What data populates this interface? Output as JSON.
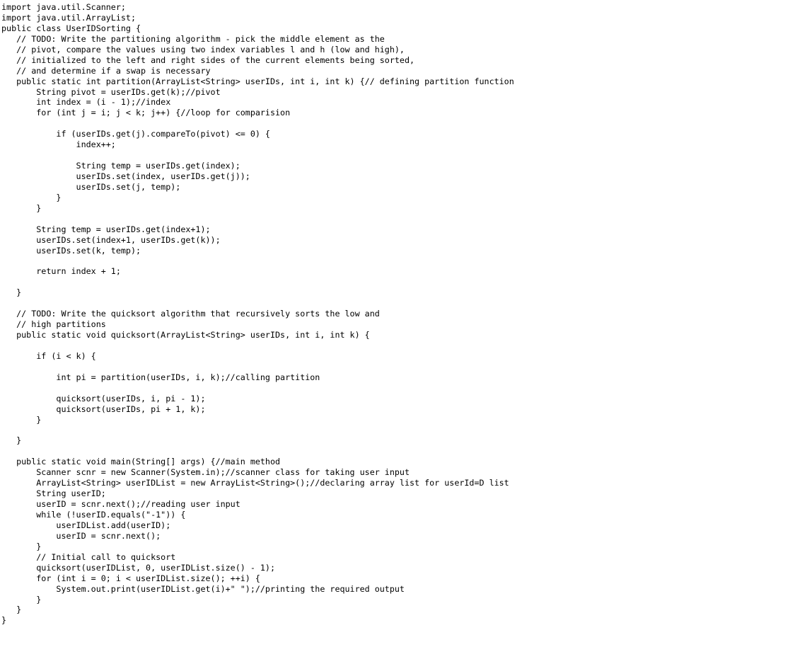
{
  "document": {
    "kind": "source-code-listing",
    "language": "Java",
    "class_name": "UserIDSorting",
    "background_color": "#ffffff",
    "text_color": "#000000",
    "top_strip_color": "#f1f1f1"
  },
  "code": {
    "lines": [
      "import java.util.Scanner;",
      "import java.util.ArrayList;",
      "public class UserIDSorting {",
      "   // TODO: Write the partitioning algorithm - pick the middle element as the",
      "   // pivot, compare the values using two index variables l and h (low and high),",
      "   // initialized to the left and right sides of the current elements being sorted,",
      "   // and determine if a swap is necessary",
      "   public static int partition(ArrayList<String> userIDs, int i, int k) {// defining partition function",
      "       String pivot = userIDs.get(k);//pivot",
      "       int index = (i - 1);//index",
      "       for (int j = i; j < k; j++) {//loop for comparision",
      "",
      "           if (userIDs.get(j).compareTo(pivot) <= 0) {",
      "               index++;",
      "",
      "               String temp = userIDs.get(index);",
      "               userIDs.set(index, userIDs.get(j));",
      "               userIDs.set(j, temp);",
      "           }",
      "       }",
      "",
      "       String temp = userIDs.get(index+1);",
      "       userIDs.set(index+1, userIDs.get(k));",
      "       userIDs.set(k, temp);",
      "",
      "       return index + 1;",
      "",
      "   }",
      "",
      "   // TODO: Write the quicksort algorithm that recursively sorts the low and",
      "   // high partitions",
      "   public static void quicksort(ArrayList<String> userIDs, int i, int k) {",
      "",
      "       if (i < k) {",
      "",
      "           int pi = partition(userIDs, i, k);//calling partition",
      "",
      "           quicksort(userIDs, i, pi - 1);",
      "           quicksort(userIDs, pi + 1, k);",
      "       }",
      "",
      "   }",
      "",
      "   public static void main(String[] args) {//main method",
      "       Scanner scnr = new Scanner(System.in);//scanner class for taking user input",
      "       ArrayList<String> userIDList = new ArrayList<String>();//declaring array list for userId=D list",
      "       String userID;",
      "       userID = scnr.next();//reading user input",
      "       while (!userID.equals(\"-1\")) {",
      "           userIDList.add(userID);",
      "           userID = scnr.next();",
      "       }",
      "       // Initial call to quicksort",
      "       quicksort(userIDList, 0, userIDList.size() - 1);",
      "       for (int i = 0; i < userIDList.size(); ++i) {",
      "           System.out.print(userIDList.get(i)+\" \");//printing the required output",
      "       }",
      "   }",
      "}"
    ]
  }
}
